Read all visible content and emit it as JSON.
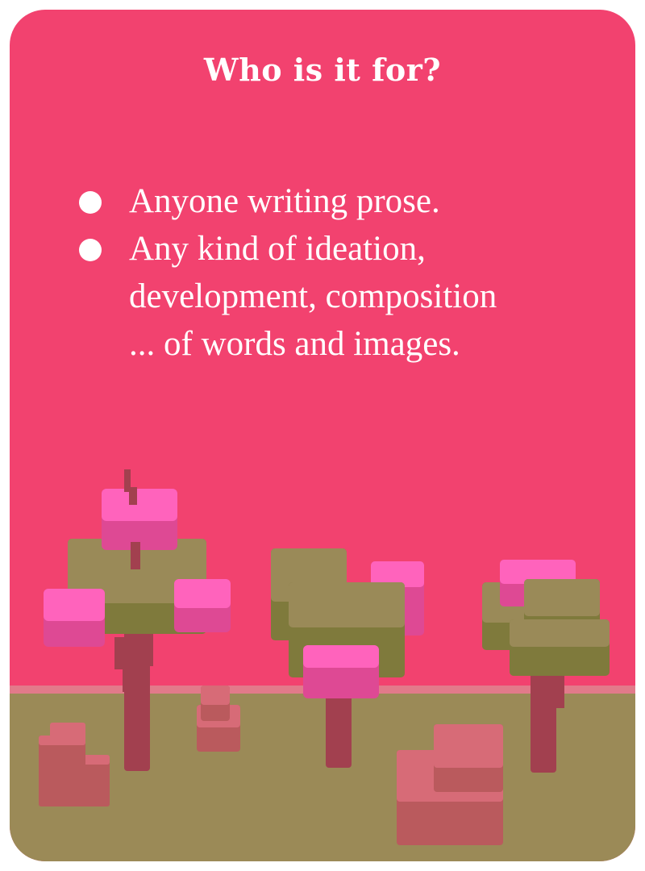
{
  "card": {
    "title": "Who is it for?",
    "bullets": [
      {
        "lines": [
          "Anyone writing prose."
        ]
      },
      {
        "lines": [
          "Any kind of ideation,",
          "development, composition",
          "... of words and images."
        ]
      }
    ]
  },
  "illustration": {
    "description_icon": "voxel-trees-illustration",
    "colors": {
      "background": "#f2426f",
      "ground": "#9b8a57",
      "ground_edge": "#e27a8a",
      "canopy_olive": "#7f7a3c",
      "canopy_olive_top": "#9a8a58",
      "canopy_pink": "#de4994",
      "canopy_pink_top": "#ff63bc",
      "trunk": "#a2404f",
      "rock": "#ba5a5d",
      "rock_top": "#d76b77"
    }
  }
}
